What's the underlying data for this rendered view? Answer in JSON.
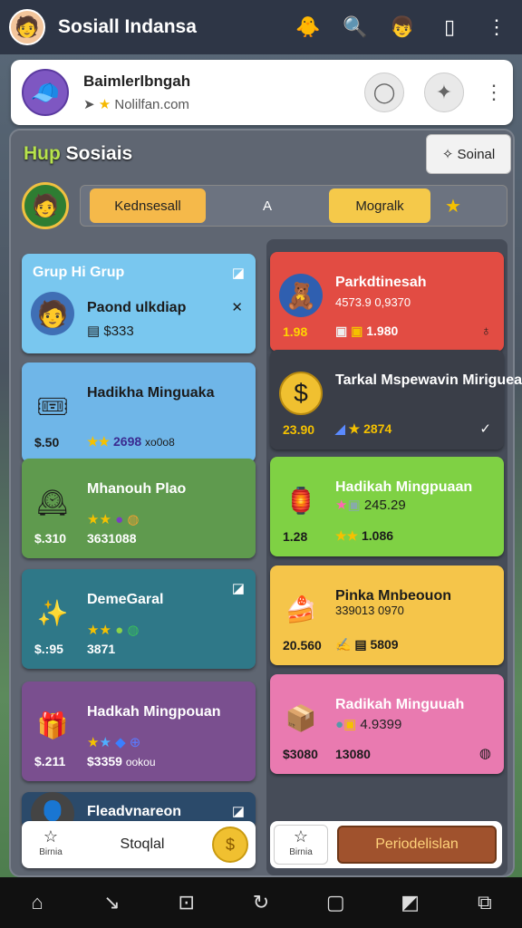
{
  "app": {
    "title": "Sosiall Indansa"
  },
  "appbar": {
    "icons": [
      "avatar-icon",
      "duck-icon",
      "search-icon",
      "character-icon",
      "phone-icon",
      "more-icon"
    ]
  },
  "profile": {
    "name": "Baimlerlbngah",
    "subtitle": "Nolilfan.com"
  },
  "panel": {
    "heading_prefix": "Hup",
    "heading_rest": " Sosiais",
    "social_button": "Soinal",
    "tabs": [
      "Kednsesall",
      "A",
      "Mogralk"
    ]
  },
  "left_cards": [
    {
      "title": "Grup Hi Grup",
      "name": "Paond ulkdiap",
      "rating": "$333",
      "color": "#79c7ef"
    },
    {
      "name": "Hadikha Minguaka",
      "price": "$.50",
      "rating_value": "2698",
      "extra": "xo0o8",
      "color": "#6fb6e8"
    },
    {
      "name": "Mhanouh Plao",
      "price": "$.310",
      "value": "3631088",
      "color": "#5f9a4e"
    },
    {
      "name": "DemeGaral",
      "price": "$.:95",
      "value": "3871",
      "color": "#2f7888"
    },
    {
      "name": "Hadkah Mingpouan",
      "price": "$.211",
      "value": "$3359",
      "extra": "ookou",
      "color": "#7a4f8f"
    },
    {
      "name": "Fleadvnareon",
      "color": "#2b4a6a"
    }
  ],
  "right_cards": [
    {
      "name": "Parkdtinesah",
      "sub": "4573.9 0,9370",
      "price": "1.98",
      "value": "1.980",
      "color": "#e24c43"
    },
    {
      "name": "Tarkal Mspewavin Miriguealli",
      "price": "23.90",
      "value": "2874",
      "color": "#3a3e48"
    },
    {
      "name": "Hadikah Mingpuaan",
      "sub": "245.29",
      "price": "1.28",
      "value": "1.086",
      "color": "#7fd144"
    },
    {
      "name": "Pinka Mnbeouon",
      "sub": "339013 0970",
      "price": "20.560",
      "value": "5809",
      "color": "#f5c54a"
    },
    {
      "name": "Radikah Minguuah",
      "sub": "4.9399",
      "price": "$3080",
      "value": "13080",
      "color": "#e97ab0"
    }
  ],
  "bottom": {
    "social_label": "Stoqlal",
    "star_caption": "Birnia",
    "primary_button": "Periodelislan"
  },
  "navbar": [
    "home-icon",
    "back-icon",
    "square-icon",
    "refresh-icon",
    "recent-icon",
    "edit-icon",
    "screenshot-icon"
  ]
}
